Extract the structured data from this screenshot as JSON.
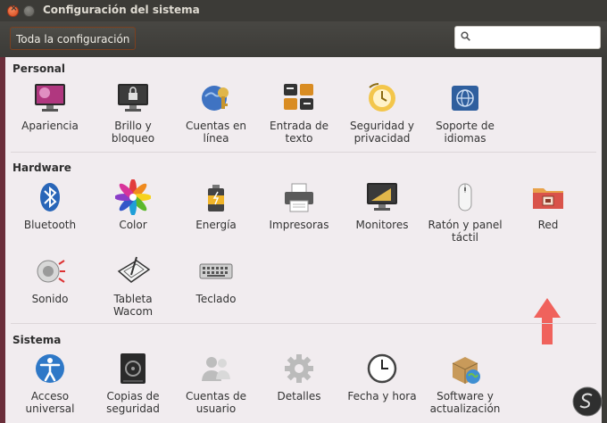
{
  "window": {
    "title": "Configuración del sistema"
  },
  "toolbar": {
    "all_settings_label": "Toda la configuración",
    "search_placeholder": ""
  },
  "sections": {
    "personal": {
      "title": "Personal",
      "items": [
        {
          "line1": "Apariencia",
          "line2": "",
          "icon": "appearance-icon"
        },
        {
          "line1": "Brillo y",
          "line2": "bloqueo",
          "icon": "brightness-lock-icon"
        },
        {
          "line1": "Cuentas en",
          "line2": "línea",
          "icon": "online-accounts-icon"
        },
        {
          "line1": "Entrada de",
          "line2": "texto",
          "icon": "text-entry-icon"
        },
        {
          "line1": "Seguridad y",
          "line2": "privacidad",
          "icon": "security-privacy-icon"
        },
        {
          "line1": "Soporte de",
          "line2": "idiomas",
          "icon": "language-support-icon"
        }
      ]
    },
    "hardware": {
      "title": "Hardware",
      "items": [
        {
          "line1": "Bluetooth",
          "line2": "",
          "icon": "bluetooth-icon"
        },
        {
          "line1": "Color",
          "line2": "",
          "icon": "color-icon"
        },
        {
          "line1": "Energía",
          "line2": "",
          "icon": "power-icon"
        },
        {
          "line1": "Impresoras",
          "line2": "",
          "icon": "printer-icon"
        },
        {
          "line1": "Monitores",
          "line2": "",
          "icon": "monitor-icon"
        },
        {
          "line1": "Ratón y panel",
          "line2": "táctil",
          "icon": "mouse-icon"
        },
        {
          "line1": "Red",
          "line2": "",
          "icon": "network-icon"
        },
        {
          "line1": "Sonido",
          "line2": "",
          "icon": "sound-icon"
        },
        {
          "line1": "Tableta",
          "line2": "Wacom",
          "icon": "wacom-tablet-icon"
        },
        {
          "line1": "Teclado",
          "line2": "",
          "icon": "keyboard-icon"
        }
      ]
    },
    "system": {
      "title": "Sistema",
      "items": [
        {
          "line1": "Acceso",
          "line2": "universal",
          "icon": "universal-access-icon"
        },
        {
          "line1": "Copias de",
          "line2": "seguridad",
          "icon": "backups-icon"
        },
        {
          "line1": "Cuentas de",
          "line2": "usuario",
          "icon": "user-accounts-icon"
        },
        {
          "line1": "Detalles",
          "line2": "",
          "icon": "details-icon"
        },
        {
          "line1": "Fecha y hora",
          "line2": "",
          "icon": "date-time-icon"
        },
        {
          "line1": "Software y",
          "line2": "actualización",
          "icon": "software-updates-icon"
        }
      ]
    }
  },
  "annotation": {
    "arrow_color": "#f0625c",
    "target": "Red"
  }
}
